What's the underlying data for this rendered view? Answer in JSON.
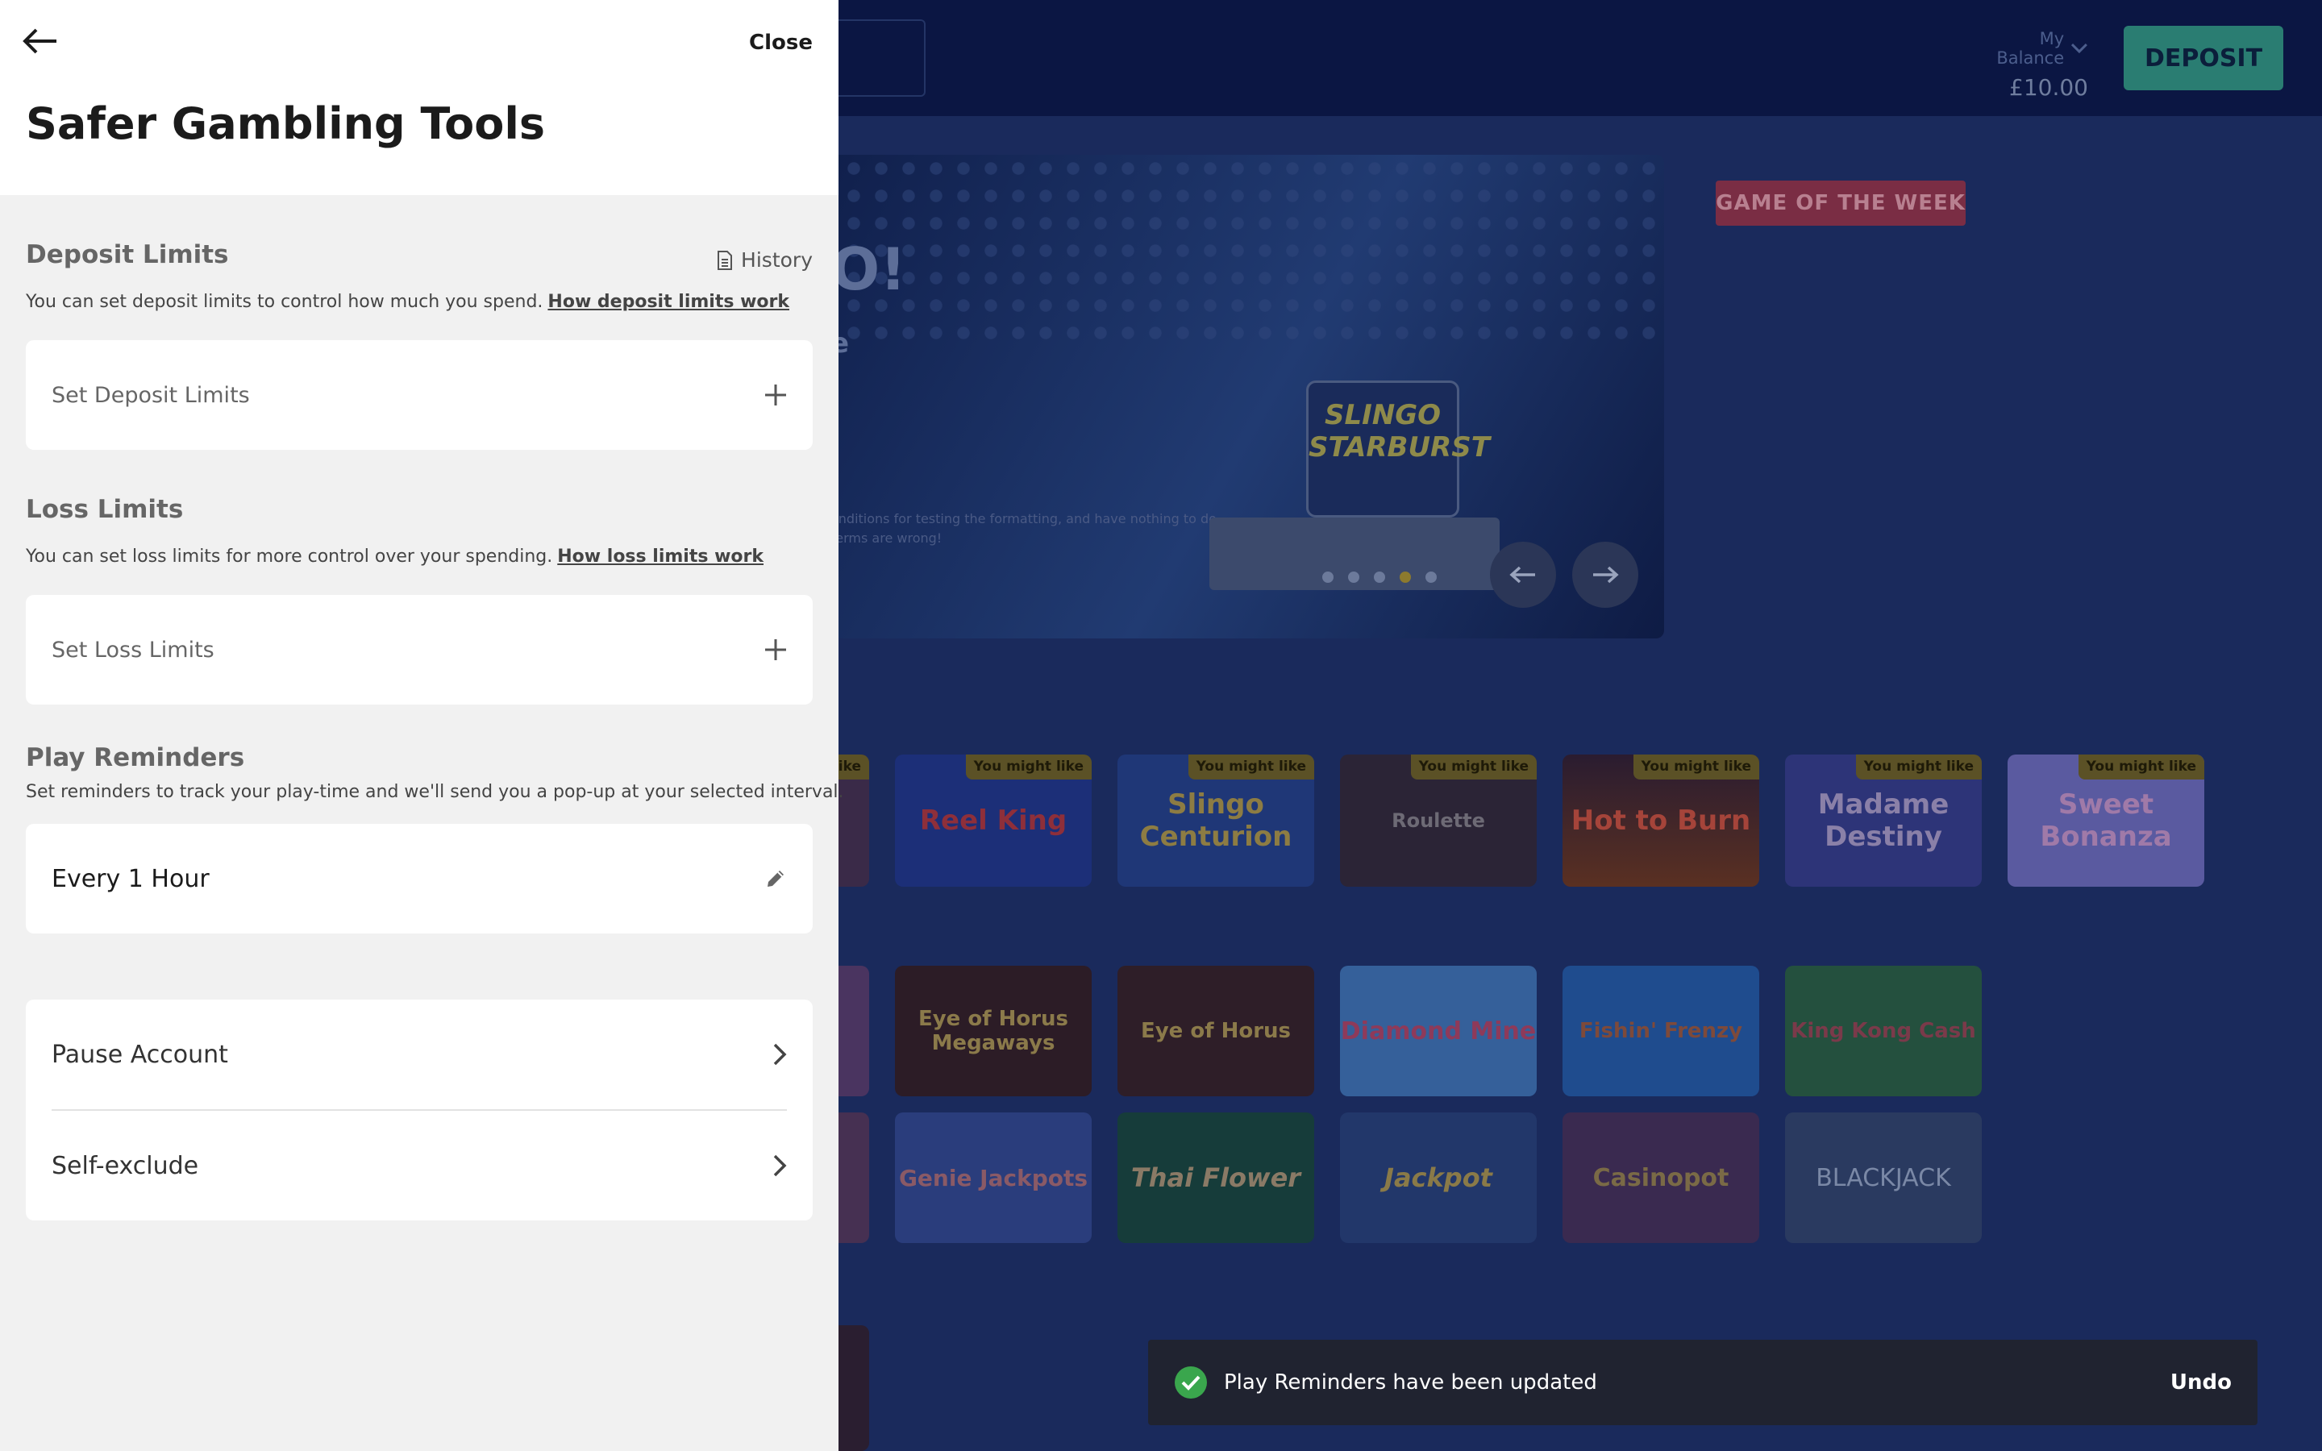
{
  "background": {
    "balance_label": "My Balance",
    "balance_value": "£10.00",
    "deposit_label": "DEPOSIT",
    "hero_headline": "O!",
    "hero_subline": "e",
    "hero_terms": "onditions for testing the formatting, and have nothing to do terms are wrong!",
    "hero_logo_text": "SLINGO STARBURST",
    "game_of_week": "GAME OF THE WEEK",
    "carousel_slides": 5,
    "carousel_active_index": 3,
    "row1_badge": "You might like",
    "row1_partial_badge": "like",
    "row1_games": [
      "Reel King",
      "Slingo Centurion",
      "Roulette",
      "Hot to Burn",
      "Madame Destiny",
      "Sweet Bonanza"
    ],
    "row2_games": [
      "Eye of Horus Megaways",
      "Eye of Horus",
      "Diamond Mine",
      "Fishin' Frenzy",
      "King Kong Cash"
    ],
    "row3_games": [
      "Genie Jackpots",
      "Thai Flower",
      "Jackpot",
      "Casinopot",
      "BLACKJACK"
    ]
  },
  "drawer": {
    "close_label": "Close",
    "title": "Safer Gambling Tools",
    "deposit": {
      "heading": "Deposit Limits",
      "history_label": "History",
      "description": "You can set deposit limits to control how much you spend.",
      "link": "How deposit limits work",
      "action_label": "Set Deposit Limits"
    },
    "loss": {
      "heading": "Loss Limits",
      "description": "You can set loss limits for more control over your spending.",
      "link": "How loss limits work",
      "action_label": "Set Loss Limits"
    },
    "reminders": {
      "heading": "Play Reminders",
      "description": "Set reminders to track your play-time and we'll send you a pop-up at your selected interval.",
      "value": "Every 1 Hour"
    },
    "account": {
      "pause_label": "Pause Account",
      "exclude_label": "Self-exclude"
    }
  },
  "toast": {
    "message": "Play Reminders have been updated",
    "undo_label": "Undo"
  }
}
